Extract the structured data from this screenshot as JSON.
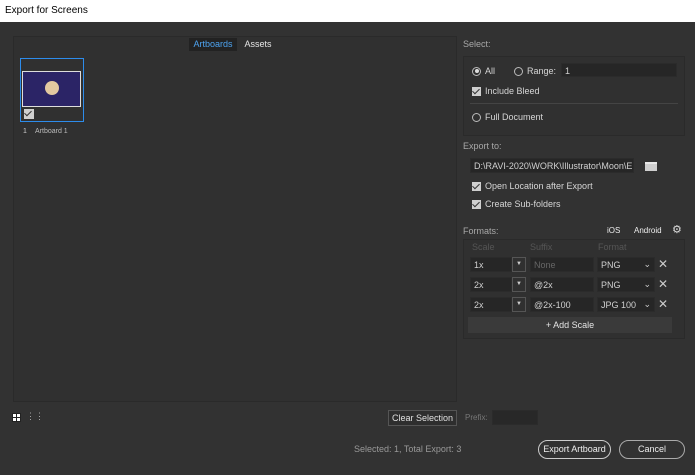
{
  "window": {
    "title": "Export for Screens"
  },
  "tabs": [
    {
      "label": "Artboards",
      "active": true
    },
    {
      "label": "Assets",
      "active": false
    }
  ],
  "artboards": [
    {
      "number": "1",
      "name": "Artboard 1",
      "checked": true
    }
  ],
  "select": {
    "label": "Select:",
    "all_label": "All",
    "all_selected": true,
    "range_label": "Range:",
    "range_value": "1",
    "include_bleed_label": "Include Bleed",
    "include_bleed": true,
    "full_document_label": "Full Document"
  },
  "export_to": {
    "label": "Export to:",
    "path": "D:\\RAVI-2020\\WORK\\Illustrator\\Moon\\E:",
    "open_location_label": "Open Location after Export",
    "open_location": true,
    "create_subfolders_label": "Create Sub-folders",
    "create_subfolders": true
  },
  "formats": {
    "label": "Formats:",
    "ios_label": "iOS",
    "android_label": "Android",
    "headers": [
      "Scale",
      "Suffix",
      "Format"
    ],
    "rows": [
      {
        "scale": "1x",
        "suffix": "",
        "suffix_placeholder": "None",
        "format": "PNG"
      },
      {
        "scale": "2x",
        "suffix": "@2x",
        "suffix_placeholder": "",
        "format": "PNG"
      },
      {
        "scale": "2x",
        "suffix": "@2x-100",
        "suffix_placeholder": "",
        "format": "JPG 100"
      }
    ],
    "add_scale_label": "+ Add Scale"
  },
  "bottom": {
    "clear_selection_label": "Clear Selection",
    "prefix_label": "Prefix:",
    "prefix_value": "",
    "status": "Selected: 1, Total Export: 3",
    "export_label": "Export Artboard",
    "cancel_label": "Cancel"
  },
  "colors": {
    "accent": "#2d8ceb",
    "background": "#323232"
  }
}
